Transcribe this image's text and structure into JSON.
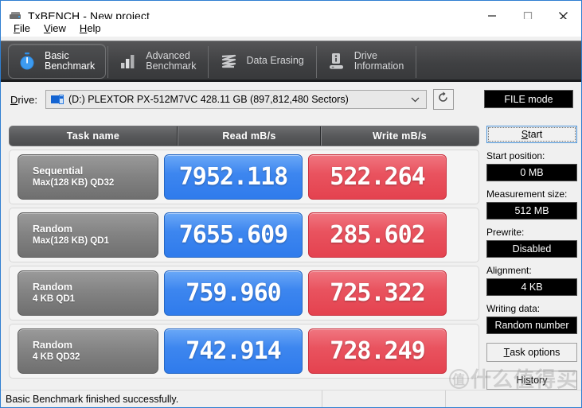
{
  "window": {
    "title": "TxBENCH - New project",
    "icon": "drive-icon",
    "minimize": "minimize-icon",
    "maximize": "maximize-icon",
    "close": "close-icon"
  },
  "menu": {
    "items": [
      {
        "label": "File",
        "accel": "F"
      },
      {
        "label": "View",
        "accel": "V"
      },
      {
        "label": "Help",
        "accel": "H"
      }
    ]
  },
  "tabs": [
    {
      "label": "Basic\nBenchmark",
      "icon": "stopwatch-icon",
      "active": true
    },
    {
      "label": "Advanced\nBenchmark",
      "icon": "bar-chart-icon",
      "active": false
    },
    {
      "label": "Data Erasing",
      "icon": "shred-icon",
      "active": false
    },
    {
      "label": "Drive\nInformation",
      "icon": "drive-info-icon",
      "active": false
    }
  ],
  "drive": {
    "label": "Drive:",
    "value": "(D:) PLEXTOR PX-512M7VC  428.11 GB (897,812,480 Sectors)",
    "icon": "disk-icon",
    "dropdown_icon": "chevron-down-icon",
    "refresh_icon": "refresh-icon",
    "mode_button": "FILE mode"
  },
  "results": {
    "columns": [
      "Task name",
      "Read mB/s",
      "Write mB/s"
    ],
    "rows": [
      {
        "task_line1": "Sequential",
        "task_line2": "Max(128 KB) QD32",
        "read": "7952.118",
        "write": "522.264"
      },
      {
        "task_line1": "Random",
        "task_line2": "Max(128 KB) QD1",
        "read": "7655.609",
        "write": "285.602"
      },
      {
        "task_line1": "Random",
        "task_line2": "4 KB QD1",
        "read": "759.960",
        "write": "725.322"
      },
      {
        "task_line1": "Random",
        "task_line2": "4 KB QD32",
        "read": "742.914",
        "write": "728.249"
      }
    ],
    "read_color": "#3d86ef",
    "write_color": "#e9535f"
  },
  "sidebar": {
    "start_button": "Start",
    "fields": [
      {
        "label": "Start position:",
        "value": "0 MB"
      },
      {
        "label": "Measurement size:",
        "value": "512 MB"
      },
      {
        "label": "Prewrite:",
        "value": "Disabled"
      },
      {
        "label": "Alignment:",
        "value": "4 KB"
      },
      {
        "label": "Writing data:",
        "value": "Random number"
      }
    ],
    "task_options_button": "Task options",
    "history_button": "History"
  },
  "statusbar": {
    "message": "Basic Benchmark finished successfully.",
    "segment2": "",
    "segment3": ""
  },
  "watermark": {
    "badge": "值",
    "text": "什么值得买"
  }
}
